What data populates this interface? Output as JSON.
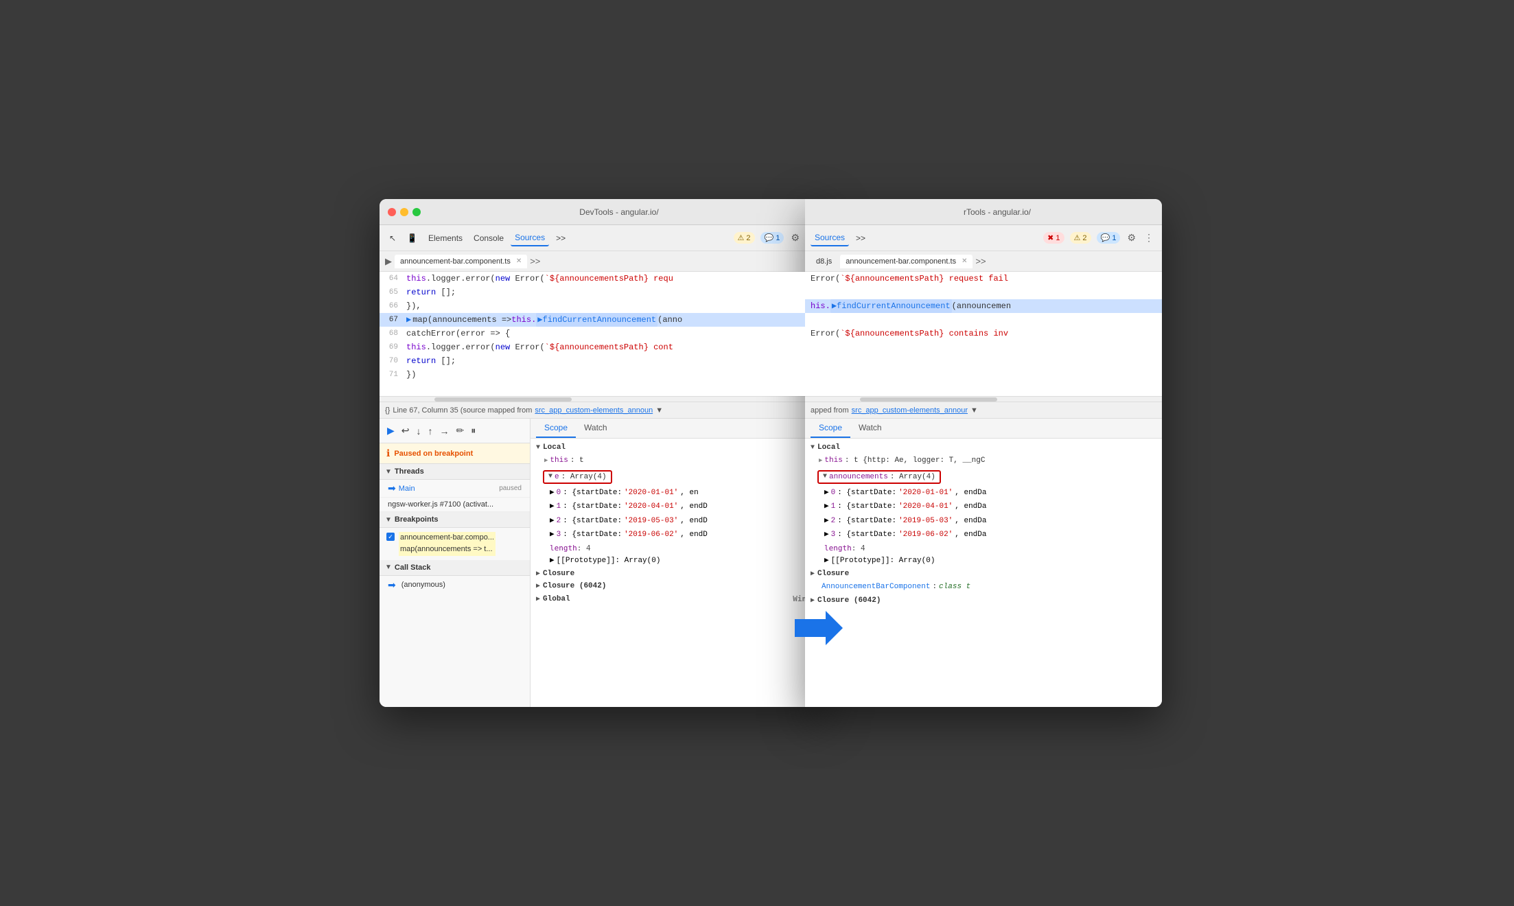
{
  "leftWindow": {
    "title": "DevTools - angular.io/",
    "toolbar": {
      "elements": "Elements",
      "console": "Console",
      "sources": "Sources",
      "more": ">>",
      "badge1": "⚠ 2",
      "badge2": "💬 1"
    },
    "tabBar": {
      "filename": "announcement-bar.component.ts",
      "chevron": ">>"
    },
    "codeLines": [
      {
        "num": "64",
        "text": "            this.logger.error(new Error(`${announcementsPath} requ",
        "highlight": false
      },
      {
        "num": "65",
        "text": "            return [];",
        "highlight": false
      },
      {
        "num": "66",
        "text": "        }),",
        "highlight": false
      },
      {
        "num": "67",
        "text": "        map(announcements => this.findCurrentAnnouncement(anno",
        "highlight": true,
        "breakpoint": true
      },
      {
        "num": "68",
        "text": "        catchError(error => {",
        "highlight": false
      },
      {
        "num": "69",
        "text": "          this.logger.error(new Error(`${announcementsPath} cont",
        "highlight": false
      },
      {
        "num": "70",
        "text": "          return [];",
        "highlight": false
      },
      {
        "num": "71",
        "text": "        })",
        "highlight": false
      }
    ],
    "statusBar": {
      "braces": "{}",
      "text": "Line 67, Column 35 (source mapped from",
      "link": "src_app_custom-elements_announ"
    },
    "debugControls": {
      "buttons": [
        "▶",
        "↩",
        "↓",
        "↑",
        "→",
        "✏",
        "⏸"
      ]
    },
    "pausedInfo": {
      "text": "Paused on breakpoint"
    },
    "threads": {
      "header": "Threads",
      "items": [
        {
          "name": "Main",
          "status": "paused",
          "active": true
        },
        {
          "name": "ngsw-worker.js #7100 (activat...",
          "status": "",
          "active": false
        }
      ]
    },
    "breakpoints": {
      "header": "Breakpoints",
      "items": [
        {
          "file": "announcement-bar.compo...",
          "code": "map(announcements => t..."
        }
      ]
    },
    "callStack": {
      "header": "Call Stack",
      "items": [
        "(anonymous)"
      ]
    },
    "scopeTabs": [
      "Scope",
      "Watch"
    ],
    "scope": {
      "local": {
        "header": "Local",
        "this": "this: t",
        "eBox": "e: Array(4)",
        "items": [
          {
            "index": "0",
            "value": "{startDate: '2020-01-01', en"
          },
          {
            "index": "1",
            "value": "{startDate: '2020-04-01', endD"
          },
          {
            "index": "2",
            "value": "{startDate: '2019-05-03', endD"
          },
          {
            "index": "3",
            "value": "{startDate: '2019-06-02', endD"
          }
        ],
        "length": "length: 4",
        "prototype": "[[Prototype]]: Array(0)"
      },
      "closure": "Closure",
      "closure2": "Closure (6042)",
      "global": "Global",
      "globalValue": "Window"
    }
  },
  "rightWindow": {
    "title": "rTools - angular.io/",
    "toolbar": {
      "sources": "Sources",
      "more": ">>",
      "badge0": "✖ 1",
      "badge1": "⚠ 2",
      "badge2": "💬 1"
    },
    "tabBar": {
      "file1": "d8.js",
      "file2": "announcement-bar.component.ts",
      "chevron": ">>"
    },
    "codeLines": [
      {
        "text": "Error(`${announcementsPath} request fail",
        "highlight": false
      },
      {
        "text": "",
        "highlight": false
      },
      {
        "text": "his.findCurrentAnnouncement(announcemen",
        "highlight": true
      },
      {
        "text": "",
        "highlight": false
      },
      {
        "text": "Error(`${announcementsPath} contains inv",
        "highlight": false
      }
    ],
    "statusBar": {
      "text": "apped from",
      "link": "src_app_custom-elements_annour"
    },
    "scopeTabs": [
      "Scope",
      "Watch"
    ],
    "scope": {
      "local": {
        "header": "Local",
        "this": "this: t {http: Ae, logger: T, __ngC",
        "announcementsBox": "announcements: Array(4)",
        "items": [
          {
            "index": "0",
            "value": "{startDate: '2020-01-01', endDa"
          },
          {
            "index": "1",
            "value": "{startDate: '2020-04-01', endDa"
          },
          {
            "index": "2",
            "value": "{startDate: '2019-05-03', endDa"
          },
          {
            "index": "3",
            "value": "{startDate: '2019-06-02', endDa"
          }
        ],
        "length": "length: 4",
        "prototype": "[[Prototype]]: Array(0)"
      },
      "closure": "Closure",
      "closureItem": "AnnouncementBarComponent: class t",
      "closure2": "Closure (6042)"
    }
  }
}
